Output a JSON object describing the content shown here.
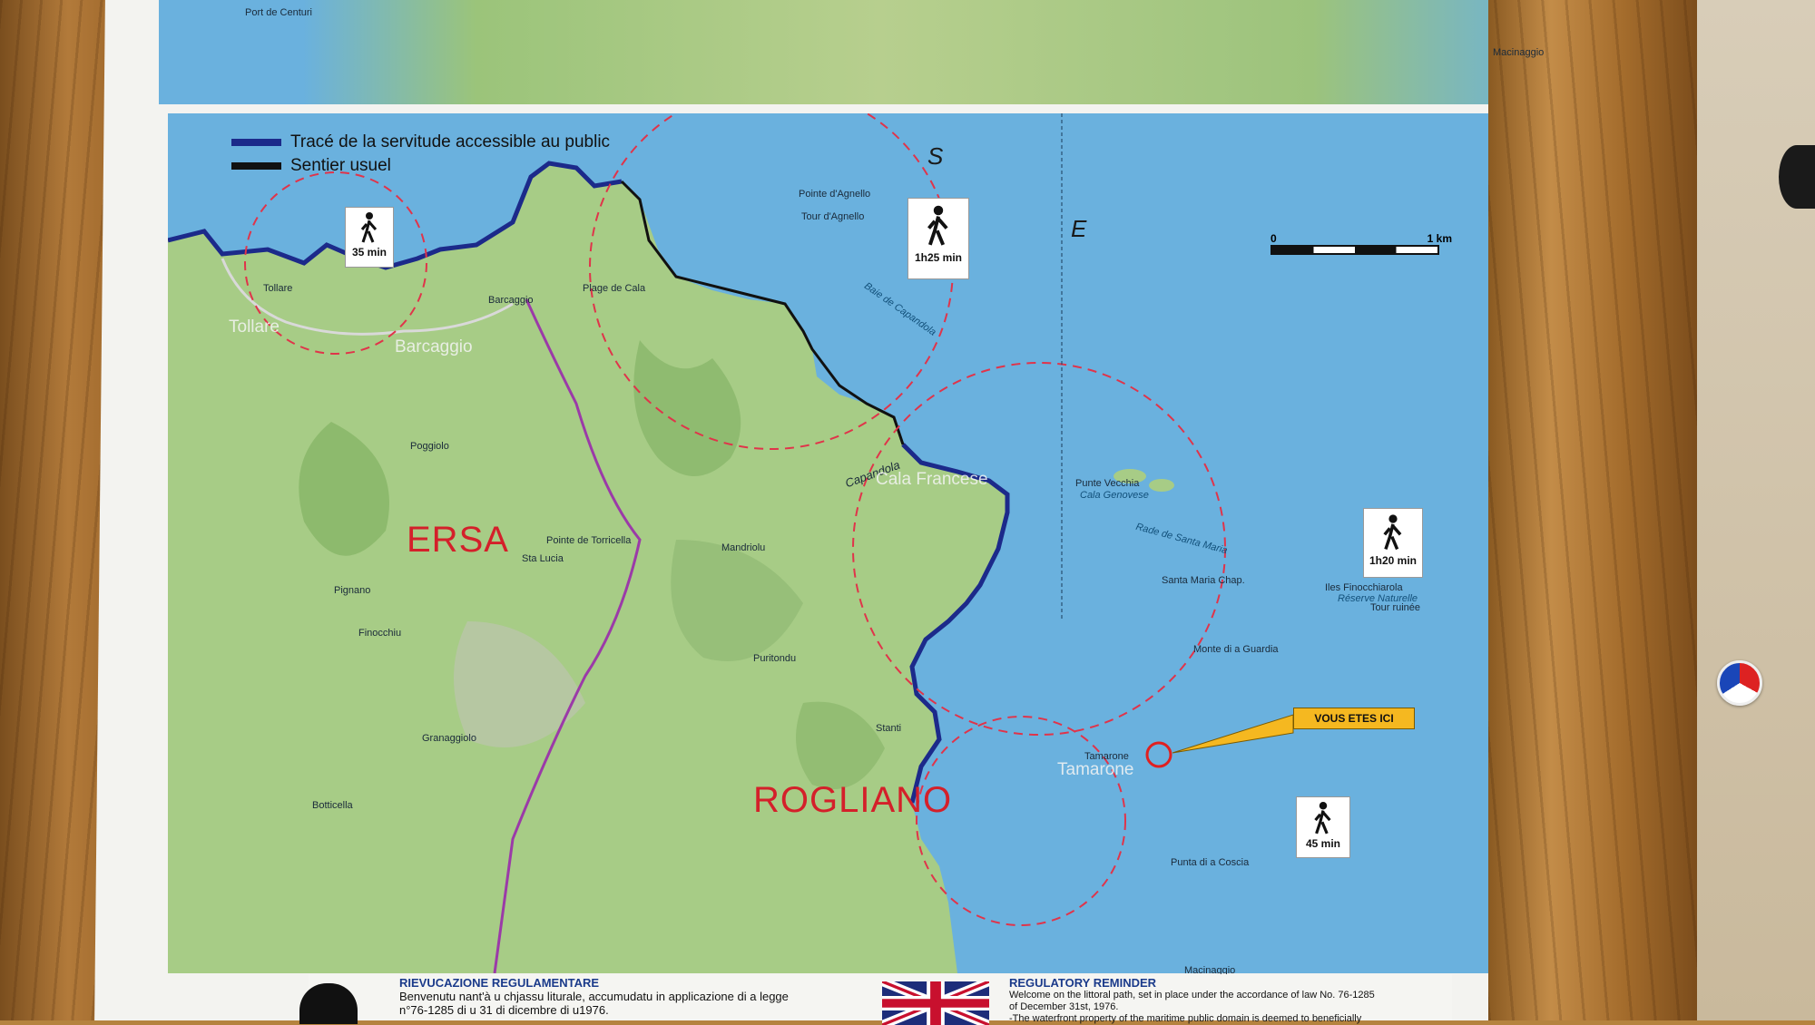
{
  "legend": {
    "items": [
      {
        "label": "Tracé de la servitude accessible au public",
        "color": "#1c2a8a"
      },
      {
        "label": "Sentier usuel",
        "color": "#111111"
      }
    ]
  },
  "hike_times": [
    "35 min",
    "1h25 min",
    "1h20 min",
    "45 min"
  ],
  "communes": [
    "ERSA",
    "ROGLIANO"
  ],
  "compass_letters": [
    "S",
    "E"
  ],
  "scale": {
    "start": "0",
    "end": "1 km"
  },
  "marker_label": "VOUS ETES ICI",
  "places": {
    "tollare": "Tollare",
    "tollare_big": "Tollare",
    "barcaggio": "Barcaggio",
    "barcaggio_big": "Barcaggio",
    "plage_cala": "Plage de Cala",
    "pointe_agnello": "Pointe d'Agnello",
    "tour_agnello": "Tour d'Agnello",
    "baie_capandola": "Baie de Capandola",
    "capandola": "Capandola",
    "cala_francese": "Cala Francese",
    "punta_vecchia": "Punte Vecchia",
    "cala_genovese": "Cala Genovese",
    "rade_santa_maria": "Rade de Santa Maria",
    "santa_maria": "Santa Maria Chap.",
    "iles_finocchiarola": "Iles Finocchiarola",
    "reserve": "Réserve Naturelle",
    "tour_ruinee": "Tour ruinée",
    "monte_guardia": "Monte di a Guardia",
    "tamarone": "Tamarone",
    "tamarone_big": "Tamarone",
    "punta_coscia": "Punta di a Coscia",
    "mandriolu": "Mandriolu",
    "puritondu": "Puritondu",
    "pointe_torricella": "Pointe de Torricella",
    "sta_lucia": "Sta Lucia",
    "pignano": "Pignano",
    "finocchiu": "Finocchiu",
    "poggiolo": "Poggiolo",
    "botticella": "Botticella",
    "granaggiolo": "Granaggiolo",
    "stanti": "Stanti",
    "macinaggio": "Macinaggio",
    "port_centuri": "Port de Centuri",
    "macinaggio_top": "Macinaggio"
  },
  "footer": {
    "corsican_title": "RIEVUCAZIONE REGULAMENTARE",
    "corsican_line1": "Benvenutu nant'à u chjassu liturale, accumudatu in applicazione di a legge",
    "corsican_line2": "n°76-1285 di u 31 di dicembre di u1976.",
    "english_title": "REGULATORY REMINDER",
    "english_line1": "Welcome on the littoral path, set in place under the accordance of law No. 76-1285",
    "english_line2": "of December 31st, 1976.",
    "english_line3": "-The waterfront property of the maritime public domain is deemed to beneficially"
  }
}
